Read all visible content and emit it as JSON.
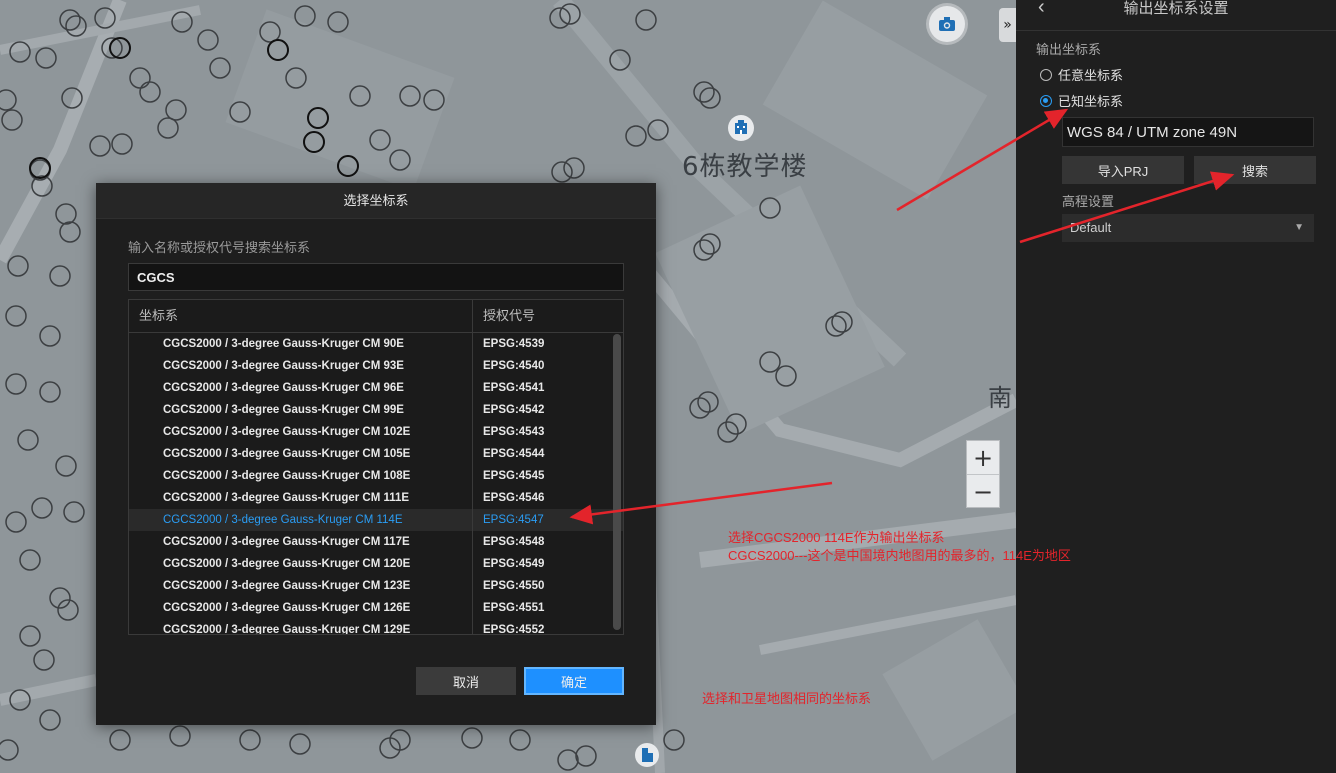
{
  "map": {
    "building_label": "6栋教学楼",
    "road_label": "南",
    "zoom_in": "+",
    "zoom_out": "−",
    "collapse": "»"
  },
  "panel": {
    "back": "‹",
    "title": "输出坐标系设置",
    "section_label": "输出坐标系",
    "radio_any": "任意坐标系",
    "radio_known": "已知坐标系",
    "crs_value": "WGS 84 / UTM zone 49N",
    "import_prj": "导入PRJ",
    "search": "搜索",
    "elevation_label": "高程设置",
    "elevation_value": "Default"
  },
  "dialog": {
    "title": "选择坐标系",
    "hint": "输入名称或授权代号搜索坐标系",
    "search_value": "CGCS",
    "col_crs": "坐标系",
    "col_code": "授权代号",
    "rows": [
      {
        "name": "CGCS2000 / 3-degree Gauss-Kruger CM 90E",
        "code": "EPSG:4539"
      },
      {
        "name": "CGCS2000 / 3-degree Gauss-Kruger CM 93E",
        "code": "EPSG:4540"
      },
      {
        "name": "CGCS2000 / 3-degree Gauss-Kruger CM 96E",
        "code": "EPSG:4541"
      },
      {
        "name": "CGCS2000 / 3-degree Gauss-Kruger CM 99E",
        "code": "EPSG:4542"
      },
      {
        "name": "CGCS2000 / 3-degree Gauss-Kruger CM 102E",
        "code": "EPSG:4543"
      },
      {
        "name": "CGCS2000 / 3-degree Gauss-Kruger CM 105E",
        "code": "EPSG:4544"
      },
      {
        "name": "CGCS2000 / 3-degree Gauss-Kruger CM 108E",
        "code": "EPSG:4545"
      },
      {
        "name": "CGCS2000 / 3-degree Gauss-Kruger CM 111E",
        "code": "EPSG:4546"
      },
      {
        "name": "CGCS2000 / 3-degree Gauss-Kruger CM 114E",
        "code": "EPSG:4547"
      },
      {
        "name": "CGCS2000 / 3-degree Gauss-Kruger CM 117E",
        "code": "EPSG:4548"
      },
      {
        "name": "CGCS2000 / 3-degree Gauss-Kruger CM 120E",
        "code": "EPSG:4549"
      },
      {
        "name": "CGCS2000 / 3-degree Gauss-Kruger CM 123E",
        "code": "EPSG:4550"
      },
      {
        "name": "CGCS2000 / 3-degree Gauss-Kruger CM 126E",
        "code": "EPSG:4551"
      },
      {
        "name": "CGCS2000 / 3-degree Gauss-Kruger CM 129E",
        "code": "EPSG:4552"
      }
    ],
    "cancel": "取消",
    "ok": "确定"
  },
  "annotations": {
    "line1": "选择CGCS2000 114E作为输出坐标系",
    "line2": "CGCS2000---这个是中国境内地图用的最多的，114E为地区",
    "line3": "选择和卫星地图相同的坐标系"
  },
  "colors": {
    "accent": "#1e90ff",
    "selected_text": "#2a9df4",
    "annotation": "#e3242b",
    "panel_bg": "#1f1f1f"
  }
}
